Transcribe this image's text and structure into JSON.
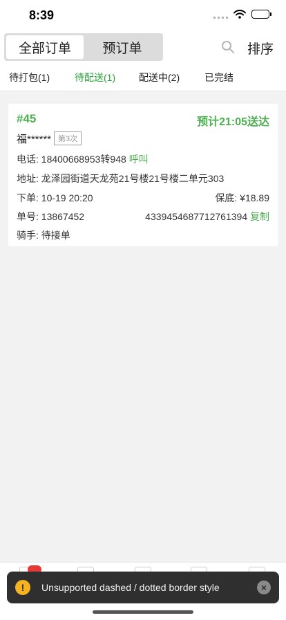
{
  "status_bar": {
    "time": "8:39"
  },
  "top_bar": {
    "segments": [
      "全部订单",
      "预订单"
    ],
    "sort_label": "排序"
  },
  "tabs": [
    {
      "label": "待打包(1)"
    },
    {
      "label": "待配送(1)"
    },
    {
      "label": "配送中(2)"
    },
    {
      "label": "已完结"
    }
  ],
  "order": {
    "number": "#45",
    "eta": "预计21:05送达",
    "customer": "福******",
    "visit_badge": "第3次",
    "phone_label": "电话: ",
    "phone": "18400668953转948",
    "call_label": "呼叫",
    "address_label": "地址: ",
    "address": "龙泽园街道天龙苑21号楼21号楼二单元303",
    "order_time_label": "下单: ",
    "order_time": "10-19 20:20",
    "insurance_label": "保底: ",
    "insurance": "¥18.89",
    "order_no_label": "单号: ",
    "order_no": "13867452",
    "tracking_no": "4339454687712761394",
    "copy_label": "复制",
    "rider_label": "骑手: ",
    "rider_status": "待接单"
  },
  "toast": {
    "message": "Unsupported dashed / dotted border style"
  }
}
